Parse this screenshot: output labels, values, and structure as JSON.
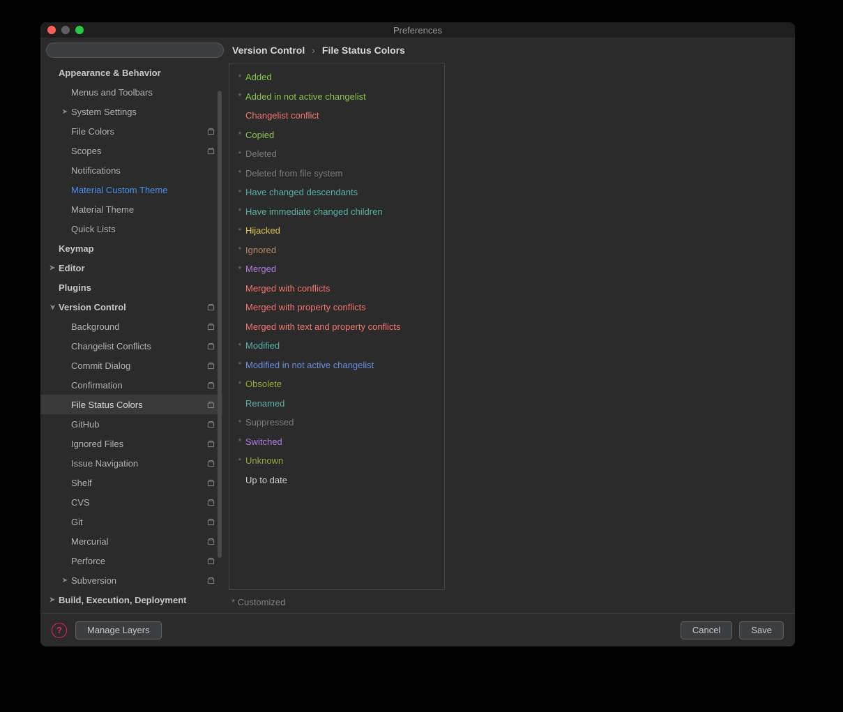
{
  "window": {
    "title": "Preferences"
  },
  "search": {
    "placeholder": ""
  },
  "breadcrumb": {
    "parent": "Version Control",
    "sep": "›",
    "child": "File Status Colors"
  },
  "sidebar": {
    "items": [
      {
        "label": "Appearance & Behavior",
        "level": 0,
        "bold": true,
        "arrow": "",
        "proj": false
      },
      {
        "label": "Menus and Toolbars",
        "level": 1,
        "bold": false,
        "arrow": "",
        "proj": false
      },
      {
        "label": "System Settings",
        "level": 1,
        "bold": false,
        "arrow": "right",
        "proj": false
      },
      {
        "label": "File Colors",
        "level": 1,
        "bold": false,
        "arrow": "",
        "proj": true
      },
      {
        "label": "Scopes",
        "level": 1,
        "bold": false,
        "arrow": "",
        "proj": true
      },
      {
        "label": "Notifications",
        "level": 1,
        "bold": false,
        "arrow": "",
        "proj": false
      },
      {
        "label": "Material Custom Theme",
        "level": 1,
        "bold": false,
        "arrow": "",
        "proj": false,
        "link": true
      },
      {
        "label": "Material Theme",
        "level": 1,
        "bold": false,
        "arrow": "",
        "proj": false
      },
      {
        "label": "Quick Lists",
        "level": 1,
        "bold": false,
        "arrow": "",
        "proj": false
      },
      {
        "label": "Keymap",
        "level": 0,
        "bold": true,
        "arrow": "",
        "proj": false
      },
      {
        "label": "Editor",
        "level": 0,
        "bold": true,
        "arrow": "right",
        "proj": false
      },
      {
        "label": "Plugins",
        "level": 0,
        "bold": true,
        "arrow": "",
        "proj": false
      },
      {
        "label": "Version Control",
        "level": 0,
        "bold": true,
        "arrow": "down",
        "proj": true
      },
      {
        "label": "Background",
        "level": 1,
        "bold": false,
        "arrow": "",
        "proj": true
      },
      {
        "label": "Changelist Conflicts",
        "level": 1,
        "bold": false,
        "arrow": "",
        "proj": true
      },
      {
        "label": "Commit Dialog",
        "level": 1,
        "bold": false,
        "arrow": "",
        "proj": true
      },
      {
        "label": "Confirmation",
        "level": 1,
        "bold": false,
        "arrow": "",
        "proj": true
      },
      {
        "label": "File Status Colors",
        "level": 1,
        "bold": false,
        "arrow": "",
        "proj": true,
        "selected": true
      },
      {
        "label": "GitHub",
        "level": 1,
        "bold": false,
        "arrow": "",
        "proj": true
      },
      {
        "label": "Ignored Files",
        "level": 1,
        "bold": false,
        "arrow": "",
        "proj": true
      },
      {
        "label": "Issue Navigation",
        "level": 1,
        "bold": false,
        "arrow": "",
        "proj": true
      },
      {
        "label": "Shelf",
        "level": 1,
        "bold": false,
        "arrow": "",
        "proj": true
      },
      {
        "label": "CVS",
        "level": 1,
        "bold": false,
        "arrow": "",
        "proj": true
      },
      {
        "label": "Git",
        "level": 1,
        "bold": false,
        "arrow": "",
        "proj": true
      },
      {
        "label": "Mercurial",
        "level": 1,
        "bold": false,
        "arrow": "",
        "proj": true
      },
      {
        "label": "Perforce",
        "level": 1,
        "bold": false,
        "arrow": "",
        "proj": true
      },
      {
        "label": "Subversion",
        "level": 1,
        "bold": false,
        "arrow": "right",
        "proj": true
      },
      {
        "label": "Build, Execution, Deployment",
        "level": 0,
        "bold": true,
        "arrow": "right",
        "proj": false
      }
    ]
  },
  "statuses": [
    {
      "label": "Added",
      "color": "#88c54e",
      "star": true
    },
    {
      "label": "Added in not active changelist",
      "color": "#88c54e",
      "star": true
    },
    {
      "label": "Changelist conflict",
      "color": "#f4756e",
      "star": false
    },
    {
      "label": "Copied",
      "color": "#88c54e",
      "star": true
    },
    {
      "label": "Deleted",
      "color": "#7a7a7a",
      "star": true
    },
    {
      "label": "Deleted from file system",
      "color": "#7a7a7a",
      "star": true
    },
    {
      "label": "Have changed descendants",
      "color": "#57b2a4",
      "star": true
    },
    {
      "label": "Have immediate changed children",
      "color": "#57b2a4",
      "star": true
    },
    {
      "label": "Hijacked",
      "color": "#e0c24a",
      "star": true
    },
    {
      "label": "Ignored",
      "color": "#b88a6a",
      "star": true
    },
    {
      "label": "Merged",
      "color": "#b07be0",
      "star": true
    },
    {
      "label": "Merged with conflicts",
      "color": "#f4756e",
      "star": false
    },
    {
      "label": "Merged with property conflicts",
      "color": "#f4756e",
      "star": false
    },
    {
      "label": "Merged with text and property conflicts",
      "color": "#f4756e",
      "star": false
    },
    {
      "label": "Modified",
      "color": "#57b2a4",
      "star": true
    },
    {
      "label": "Modified in not active changelist",
      "color": "#6a8fe0",
      "star": true
    },
    {
      "label": "Obsolete",
      "color": "#9aa53a",
      "star": true
    },
    {
      "label": "Renamed",
      "color": "#57b2a4",
      "star": false
    },
    {
      "label": "Suppressed",
      "color": "#7a7a7a",
      "star": true
    },
    {
      "label": "Switched",
      "color": "#b07be0",
      "star": true
    },
    {
      "label": "Unknown",
      "color": "#9aa53a",
      "star": true
    },
    {
      "label": "Up to date",
      "color": "#d0d0d0",
      "star": false
    }
  ],
  "note": "* Customized",
  "footer": {
    "manage_layers": "Manage Layers",
    "cancel": "Cancel",
    "save": "Save"
  }
}
